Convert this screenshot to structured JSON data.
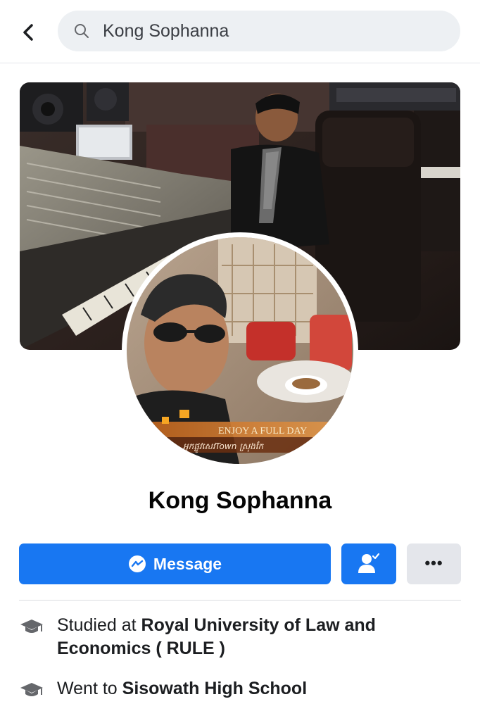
{
  "header": {
    "back_icon": "chevron-left-icon",
    "search_icon": "search-icon",
    "search_value": "Kong Sophanna"
  },
  "profile": {
    "name": "Kong Sophanna",
    "cover_photo": "studio-mixing-console-photo",
    "avatar_photo": "man-with-sunglasses-photo",
    "avatar_overlay_line1": "ENJOY A FULL DAY",
    "avatar_overlay_line2": "អ្នកផ្លូវសេវTown ស្រុងកែ"
  },
  "actions": {
    "message_label": "Message",
    "message_icon": "messenger-icon",
    "friend_icon": "add-friend-icon",
    "more_label": "•••",
    "accent_color": "#1877f2"
  },
  "intro": [
    {
      "icon": "graduation-cap-icon",
      "prefix": "Studied at ",
      "name": "Royal University of Law and Economics ( RULE )"
    },
    {
      "icon": "graduation-cap-icon",
      "prefix": "Went to ",
      "name": "Sisowath High School"
    }
  ]
}
